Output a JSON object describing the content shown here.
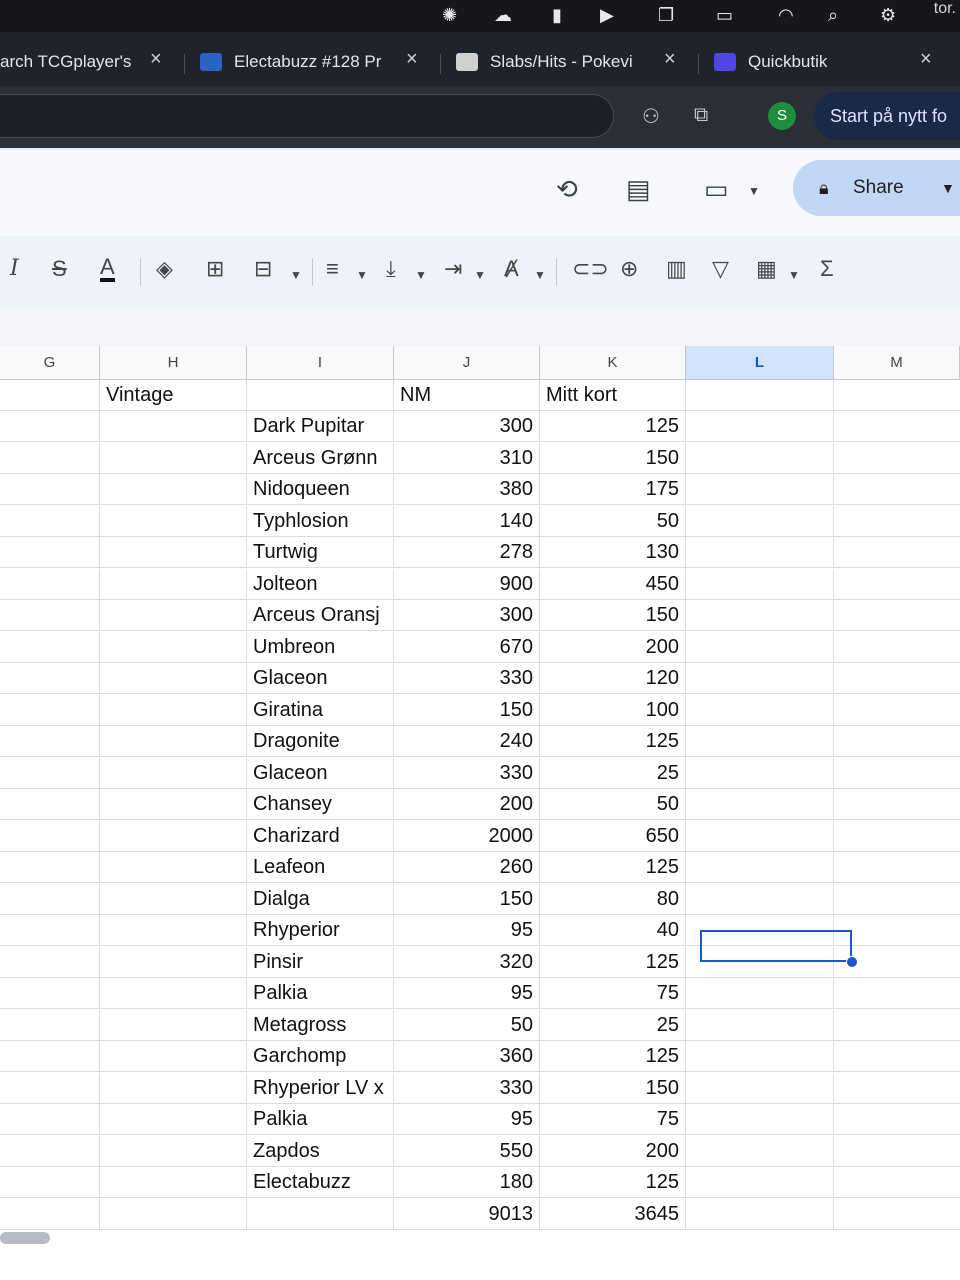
{
  "menubar": {
    "clock": "tor."
  },
  "tabs": [
    {
      "title": "arch TCGplayer's",
      "favicon_color": "#1f232b"
    },
    {
      "title": "Electabuzz #128 Pr",
      "favicon_color": "#2b63c4"
    },
    {
      "title": "Slabs/Hits - Pokevi",
      "favicon_color": "#cfcfcf"
    },
    {
      "title": "Quickbutik",
      "favicon_color": "#4f46e5"
    }
  ],
  "browser": {
    "avatar_letter": "S",
    "restart_label": "Start på nytt fo"
  },
  "sheets": {
    "share_label": "Share"
  },
  "toolbar": {
    "sum_label": "Σ",
    "text_color_label": "A"
  },
  "columns": [
    "G",
    "H",
    "I",
    "J",
    "K",
    "L",
    "M"
  ],
  "selected_column": "L",
  "header_row": {
    "H": "Vintage",
    "J": "NM",
    "K": "Mitt kort"
  },
  "rows": [
    {
      "name": "Dark Pupitar",
      "nm": "300",
      "mitt": "125"
    },
    {
      "name": "Arceus Grønn",
      "nm": "310",
      "mitt": "150"
    },
    {
      "name": "Nidoqueen",
      "nm": "380",
      "mitt": "175"
    },
    {
      "name": "Typhlosion",
      "nm": "140",
      "mitt": "50"
    },
    {
      "name": "Turtwig",
      "nm": "278",
      "mitt": "130"
    },
    {
      "name": "Jolteon",
      "nm": "900",
      "mitt": "450"
    },
    {
      "name": "Arceus Oransj",
      "nm": "300",
      "mitt": "150"
    },
    {
      "name": "Umbreon",
      "nm": "670",
      "mitt": "200"
    },
    {
      "name": "Glaceon",
      "nm": "330",
      "mitt": "120"
    },
    {
      "name": "Giratina",
      "nm": "150",
      "mitt": "100"
    },
    {
      "name": "Dragonite",
      "nm": "240",
      "mitt": "125"
    },
    {
      "name": "Glaceon",
      "nm": "330",
      "mitt": "25"
    },
    {
      "name": "Chansey",
      "nm": "200",
      "mitt": "50"
    },
    {
      "name": "Charizard",
      "nm": "2000",
      "mitt": "650"
    },
    {
      "name": "Leafeon",
      "nm": "260",
      "mitt": "125"
    },
    {
      "name": "Dialga",
      "nm": "150",
      "mitt": "80"
    },
    {
      "name": "Rhyperior",
      "nm": "95",
      "mitt": "40"
    },
    {
      "name": "Pinsir",
      "nm": "320",
      "mitt": "125"
    },
    {
      "name": "Palkia",
      "nm": "95",
      "mitt": "75"
    },
    {
      "name": "Metagross",
      "nm": "50",
      "mitt": "25"
    },
    {
      "name": "Garchomp",
      "nm": "360",
      "mitt": "125"
    },
    {
      "name": "Rhyperior LV x",
      "nm": "330",
      "mitt": "150"
    },
    {
      "name": "Palkia",
      "nm": "95",
      "mitt": "75"
    },
    {
      "name": "Zapdos",
      "nm": "550",
      "mitt": "200"
    },
    {
      "name": "Electabuzz",
      "nm": "180",
      "mitt": "125"
    }
  ],
  "totals": {
    "nm": "9013",
    "mitt": "3645"
  },
  "colors": {
    "accent": "#1a56c4",
    "selected_header": "#d3e3fd"
  }
}
